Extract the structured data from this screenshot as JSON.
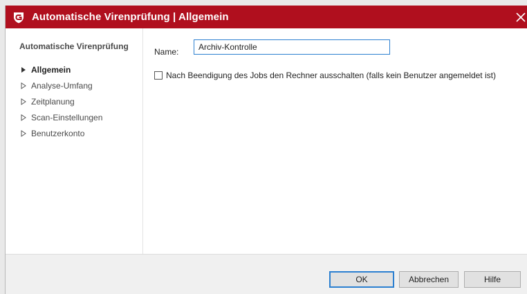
{
  "window": {
    "title": "Automatische Virenprüfung | Allgemein",
    "brand_color": "#b00f1e",
    "close_symbol": "✕",
    "logo_icon": "gdata-shield-logo"
  },
  "sidebar": {
    "heading": "Automatische Virenprüfung",
    "items": [
      {
        "label": "Allgemein",
        "active": true
      },
      {
        "label": "Analyse-Umfang",
        "active": false
      },
      {
        "label": "Zeitplanung",
        "active": false
      },
      {
        "label": "Scan-Einstellungen",
        "active": false
      },
      {
        "label": "Benutzerkonto",
        "active": false
      }
    ]
  },
  "main": {
    "name_label": "Name:",
    "name_value": "Archiv-Kontrolle",
    "shutdown_checkbox_label": "Nach Beendigung des Jobs den Rechner ausschalten (falls kein Benutzer angemeldet ist)",
    "shutdown_checked": false
  },
  "footer": {
    "ok_label": "OK",
    "cancel_label": "Abbrechen",
    "help_label": "Hilfe"
  },
  "colors": {
    "focus_blue": "#2b7fd0"
  }
}
